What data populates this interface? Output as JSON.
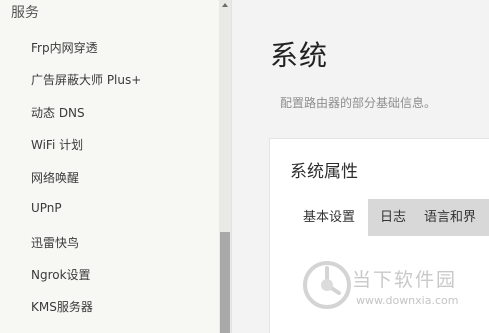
{
  "sidebar": {
    "section_title": "服务",
    "items": [
      {
        "label": "Frp内网穿透"
      },
      {
        "label": "广告屏蔽大师 Plus+"
      },
      {
        "label": "动态 DNS"
      },
      {
        "label": "WiFi 计划"
      },
      {
        "label": "网络唤醒"
      },
      {
        "label": "UPnP"
      },
      {
        "label": "迅雷快鸟"
      },
      {
        "label": "Ngrok设置"
      },
      {
        "label": "KMS服务器"
      }
    ]
  },
  "main": {
    "title": "系统",
    "subtitle": "配置路由器的部分基础信息。",
    "panel": {
      "title": "系统属性",
      "tabs": [
        {
          "label": "基本设置",
          "active": true
        },
        {
          "label": "日志",
          "active": false
        },
        {
          "label": "语言和界",
          "active": false
        }
      ]
    }
  },
  "watermark": {
    "title": "当下软件园",
    "url": "www.downxia.com"
  },
  "colors": {
    "sidebar_bg": "#f7f7f3",
    "main_bg": "#f3f3f3",
    "tab_bar_bg": "#d8d8d8",
    "active_tab_bg": "#ffffff"
  }
}
